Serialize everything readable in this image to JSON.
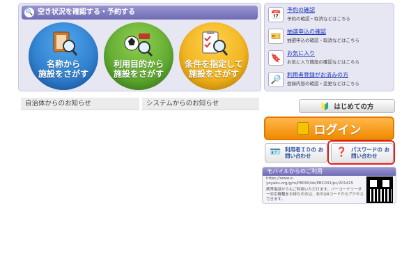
{
  "search": {
    "header": "空き状況を確認する・予約する",
    "circles": [
      {
        "line1": "名称から",
        "line2": "施設をさがす"
      },
      {
        "line1": "利用目的から",
        "line2": "施設をさがす"
      },
      {
        "line1": "条件を指定して",
        "line2": "施設をさがす"
      }
    ]
  },
  "notices": {
    "local_gov": "自治体からのお知らせ",
    "system": "システムからのお知らせ"
  },
  "sidebar": {
    "items": [
      {
        "title": "予約の確認",
        "desc": "予約の確認・取消などはこちら"
      },
      {
        "title": "抽選申込の確認",
        "desc": "抽選申込の確認・取消などはこちら"
      },
      {
        "title": "お気に入り",
        "desc": "お気に入り施設の確認などはこちら"
      },
      {
        "title": "利用者登録がお済みの方",
        "desc": "登録内容の確認・変更などはこちら"
      }
    ]
  },
  "buttons": {
    "hajimete": "はじめての方",
    "login": "ログイン",
    "user_id_inquiry": "利用者ＩＤの お問い合わせ",
    "password_inquiry": "パスワードの お問い合わせ"
  },
  "mobile": {
    "title": "モバイルからのご利用",
    "url": "https://www.e-yoyaku.org/g/m/PB000/ds/PBC031/pc/201415",
    "desc": "携帯電話からもご利用いただけます。バーコードリーダー対応機種をお持ちの方は、右のQRコードからアクセスできます。"
  },
  "colors": {
    "accent": "#6f6bb5",
    "login": "#f08a00",
    "highlight": "#e21b1b"
  }
}
